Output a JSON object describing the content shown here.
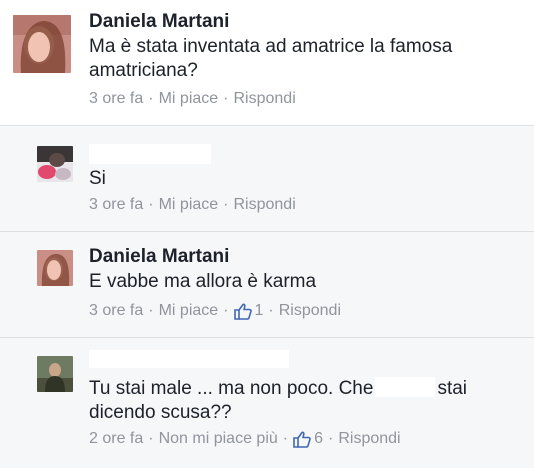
{
  "comments": [
    {
      "author": "Daniela Martani",
      "lines": [
        "Ma è stata inventata ad amatrice la famosa",
        "amatriciana?"
      ],
      "time": "3 ore fa",
      "like_label": "Mi piace",
      "reply_label": "Rispondi",
      "like_count": ""
    },
    {
      "author": "",
      "lines": [
        "Si"
      ],
      "time": "3 ore fa",
      "like_label": "Mi piace",
      "reply_label": "Rispondi",
      "like_count": ""
    },
    {
      "author": "Daniela Martani",
      "lines": [
        "E vabbe ma allora è karma"
      ],
      "time": "3 ore fa",
      "like_label": "Mi piace",
      "reply_label": "Rispondi",
      "like_count": "1"
    },
    {
      "author": "",
      "line1_before": "Tu stai male ... ma non poco. Che",
      "line1_after": "stai",
      "line2": "dicendo scusa??",
      "time": "2 ore fa",
      "like_label": "Non mi piace più",
      "reply_label": "Rispondi",
      "like_count": "6"
    }
  ],
  "separator": "·",
  "colors": {
    "meta": "#90949c",
    "like_blue": "#4267b2",
    "text": "#1d2129"
  },
  "icons": {
    "like": "thumbs-up-icon"
  }
}
